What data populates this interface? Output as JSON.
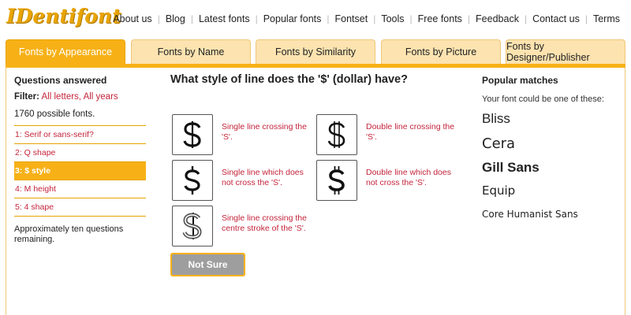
{
  "header": {
    "logo": "IDentifont",
    "nav": [
      "About us",
      "Blog",
      "Latest fonts",
      "Popular fonts",
      "Fontset",
      "Tools",
      "Free fonts",
      "Feedback",
      "Contact us",
      "Terms"
    ]
  },
  "tabs": [
    "Fonts by Appearance",
    "Fonts by Name",
    "Fonts by Similarity",
    "Fonts by Picture",
    "Fonts by Designer/Publisher"
  ],
  "sidebar": {
    "title": "Questions answered",
    "filter_label": "Filter:",
    "filter_value": "All letters, All years",
    "count": "1760 possible fonts.",
    "questions": [
      "1: Serif or sans-serif?",
      "2: Q shape",
      "3: $ style",
      "4: M height",
      "5: 4 shape"
    ],
    "remaining": "Approximately ten questions remaining."
  },
  "question": {
    "title": "What style of line does the '$' (dollar) have?",
    "choices": [
      "Single line crossing the 'S'.",
      "Double line crossing the 'S'.",
      "Single line which does not cross the 'S'.",
      "Double line which does not cross the 'S'.",
      "Single line crossing the centre stroke of the 'S'."
    ],
    "not_sure": "Not Sure"
  },
  "popular": {
    "title": "Popular matches",
    "subtitle": "Your font could be one of these:",
    "fonts": [
      "Bliss",
      "Cera",
      "Gill Sans",
      "Equip",
      "Core Humanist Sans"
    ]
  },
  "colors": {
    "accent": "#f7b117",
    "tab_inactive": "#fce3b0",
    "link_red": "#c4243b"
  }
}
